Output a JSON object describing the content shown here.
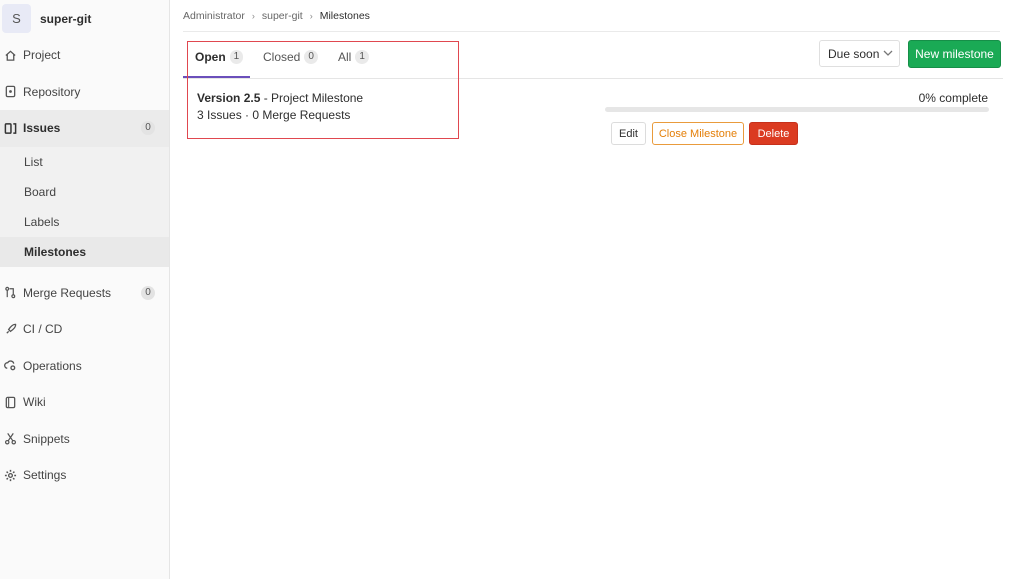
{
  "project": {
    "avatar_letter": "S",
    "name": "super-git"
  },
  "sidebar": {
    "items": [
      {
        "label": "Project",
        "icon": "home-icon"
      },
      {
        "label": "Repository",
        "icon": "doc-icon"
      },
      {
        "label": "Issues",
        "icon": "issues-icon",
        "count": "0"
      },
      {
        "label": "Merge Requests",
        "icon": "merge-request-icon",
        "count": "0"
      },
      {
        "label": "CI / CD",
        "icon": "rocket-icon"
      },
      {
        "label": "Operations",
        "icon": "cloud-gear-icon"
      },
      {
        "label": "Wiki",
        "icon": "book-icon"
      },
      {
        "label": "Snippets",
        "icon": "scissors-icon"
      },
      {
        "label": "Settings",
        "icon": "gear-icon"
      }
    ],
    "issues_sub": [
      "List",
      "Board",
      "Labels",
      "Milestones"
    ]
  },
  "breadcrumb": [
    "Administrator",
    "super-git",
    "Milestones"
  ],
  "tabs": [
    {
      "label": "Open",
      "count": "1"
    },
    {
      "label": "Closed",
      "count": "0"
    },
    {
      "label": "All",
      "count": "1"
    }
  ],
  "sort": {
    "selected": "Due soon"
  },
  "new_milestone_label": "New milestone",
  "milestone": {
    "name": "Version 2.5",
    "scope": "- Project Milestone",
    "stats": "3 Issues · 0 Merge Requests",
    "progress_text": "0% complete",
    "progress_pct": 0,
    "edit_label": "Edit",
    "close_label": "Close Milestone",
    "delete_label": "Delete"
  },
  "colors": {
    "accent": "#6b4fbb",
    "success": "#1aaa55",
    "danger": "#db3b21",
    "warning": "#e47f08",
    "highlight_box": "#e0474f"
  }
}
